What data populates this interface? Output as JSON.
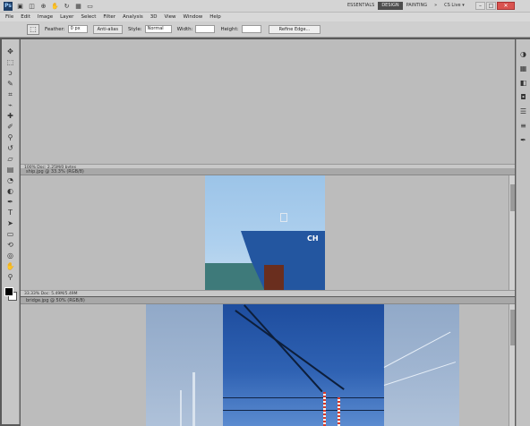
{
  "app": {
    "logo": "Ps",
    "workspaces": [
      "ESSENTIALS",
      "DESIGN",
      "PAINTING",
      "»"
    ],
    "active_workspace": "ESSENTIALS",
    "csl": "CS Live ▾"
  },
  "menu": [
    "File",
    "Edit",
    "Image",
    "Layer",
    "Select",
    "Filter",
    "Analysis",
    "3D",
    "View",
    "Window",
    "Help"
  ],
  "options": {
    "feather_label": "Feather:",
    "feather_value": "0 px",
    "antialias_label": "Anti-alias",
    "style_label": "Style:",
    "style_value": "Normal",
    "width_label": "Width:",
    "height_label": "Height:",
    "refine_label": "Refine Edge..."
  },
  "documents": [
    {
      "tab": "Untitled-1 @ 100% (RGB/8)",
      "status": "100%   Doc: 2.25M/0 bytes"
    },
    {
      "tab": "ship.jpg @ 33.3% (RGB/8)",
      "status": "33.33%   Doc: 5.49M/5.49M"
    },
    {
      "tab": "bridge.jpg @ 50% (RGB/8)",
      "status": "50%   Doc: 12.0M/12.0M"
    }
  ],
  "ship_text": "CH",
  "colors": {
    "foreground": "#000000",
    "background": "#ffffff",
    "canvas": "#bcbcbc",
    "close": "#d9534f"
  }
}
